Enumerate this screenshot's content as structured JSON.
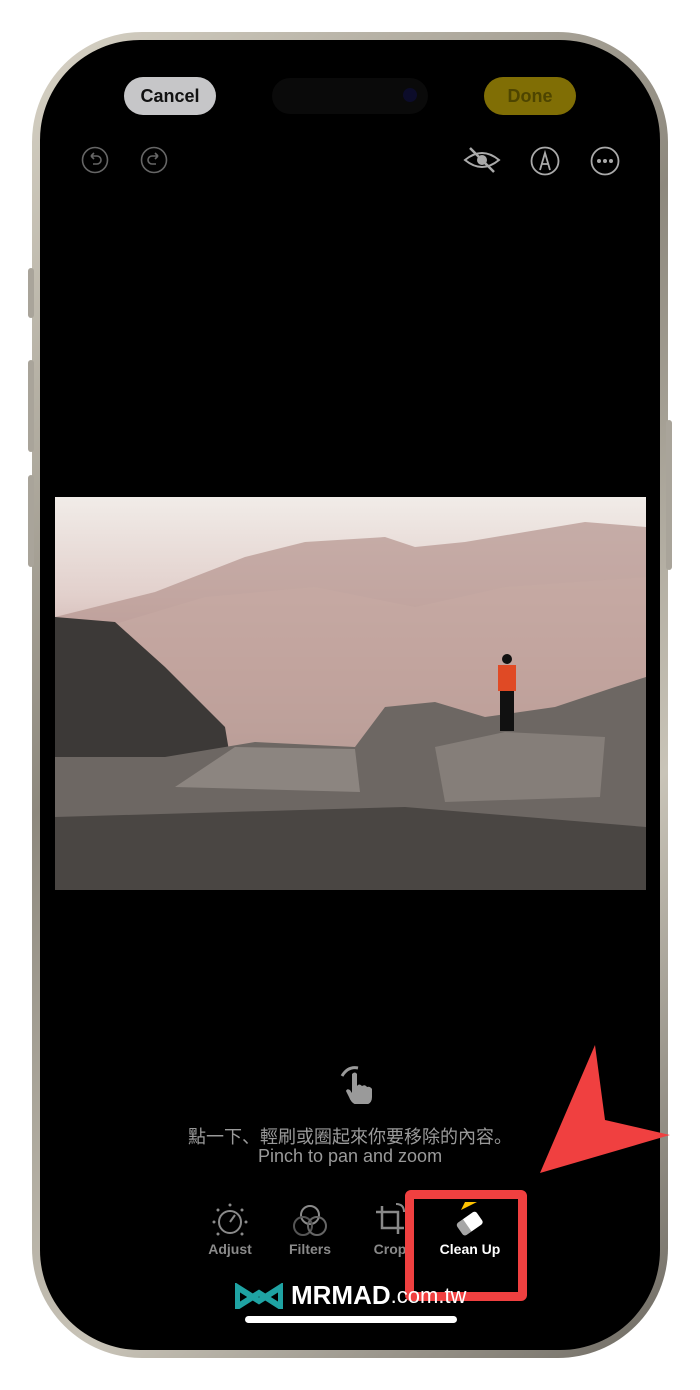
{
  "header": {
    "cancel_label": "Cancel",
    "done_label": "Done"
  },
  "toolbar_icons": [
    "undo-icon",
    "redo-icon",
    "hide-eye-icon",
    "markup-icon",
    "more-icon"
  ],
  "hint": {
    "line_zh": "點一下、輕刷或圈起來你要移除的內容。",
    "line_en": "Pinch to pan and zoom"
  },
  "tools": [
    {
      "label": "Adjust"
    },
    {
      "label": "Filters"
    },
    {
      "label": "Crop"
    },
    {
      "label": "Clean Up",
      "selected": true
    }
  ],
  "watermark": {
    "text": "MRMAD",
    "suffix": ".com.tw"
  },
  "colors": {
    "accent": "#ffc300",
    "annotation": "#f04040",
    "done_bg": "#806e05"
  }
}
